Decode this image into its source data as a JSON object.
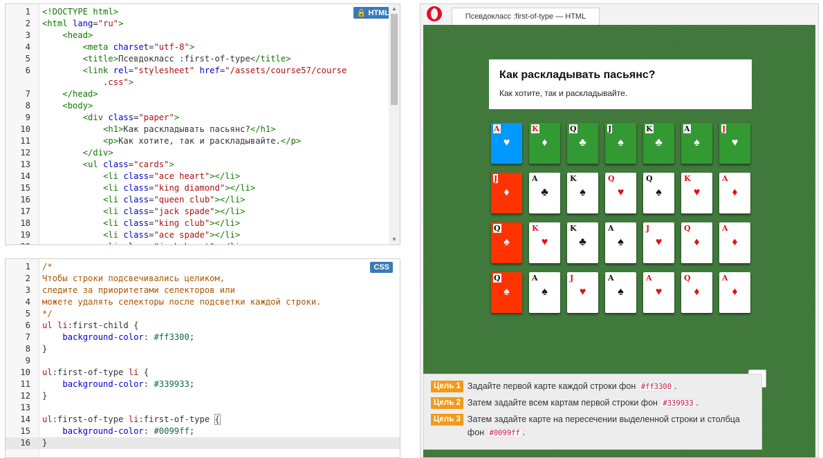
{
  "html_editor": {
    "badge": "HTML",
    "lines": [
      {
        "n": "1",
        "html": "<span class=\"t-tag\">&lt;!DOCTYPE html&gt;</span>"
      },
      {
        "n": "2",
        "html": "<span class=\"t-tag\">&lt;html</span> <span class=\"t-attr\">lang</span>=<span class=\"t-str\">\"ru\"</span><span class=\"t-tag\">&gt;</span>"
      },
      {
        "n": "3",
        "html": "    <span class=\"t-tag\">&lt;head&gt;</span>"
      },
      {
        "n": "4",
        "html": "        <span class=\"t-tag\">&lt;meta</span> <span class=\"t-attr\">charset</span>=<span class=\"t-str\">\"utf-8\"</span><span class=\"t-tag\">&gt;</span>"
      },
      {
        "n": "5",
        "html": "        <span class=\"t-tag\">&lt;title&gt;</span>Псевдокласс :first-of-type<span class=\"t-tag\">&lt;/title&gt;</span>"
      },
      {
        "n": "6",
        "html": "        <span class=\"t-tag\">&lt;link</span> <span class=\"t-attr\">rel</span>=<span class=\"t-str\">\"stylesheet\"</span> <span class=\"t-attr\">href</span>=<span class=\"t-str\">\"/assets/course57/course</span>"
      },
      {
        "n": "",
        "html": "            <span class=\"t-str\">.css\"</span><span class=\"t-tag\">&gt;</span>"
      },
      {
        "n": "7",
        "html": "    <span class=\"t-tag\">&lt;/head&gt;</span>"
      },
      {
        "n": "8",
        "html": "    <span class=\"t-tag\">&lt;body&gt;</span>"
      },
      {
        "n": "9",
        "html": "        <span class=\"t-tag\">&lt;div</span> <span class=\"t-attr\">class</span>=<span class=\"t-str\">\"paper\"</span><span class=\"t-tag\">&gt;</span>"
      },
      {
        "n": "10",
        "html": "            <span class=\"t-tag\">&lt;h1&gt;</span>Как раскладывать пасьянс?<span class=\"t-tag\">&lt;/h1&gt;</span>"
      },
      {
        "n": "11",
        "html": "            <span class=\"t-tag\">&lt;p&gt;</span>Как хотите, так и раскладывайте.<span class=\"t-tag\">&lt;/p&gt;</span>"
      },
      {
        "n": "12",
        "html": "        <span class=\"t-tag\">&lt;/div&gt;</span>"
      },
      {
        "n": "13",
        "html": "        <span class=\"t-tag\">&lt;ul</span> <span class=\"t-attr\">class</span>=<span class=\"t-str\">\"cards\"</span><span class=\"t-tag\">&gt;</span>"
      },
      {
        "n": "14",
        "html": "            <span class=\"t-tag\">&lt;li</span> <span class=\"t-attr\">class</span>=<span class=\"t-str\">\"ace heart\"</span><span class=\"t-tag\">&gt;&lt;/li&gt;</span>"
      },
      {
        "n": "15",
        "html": "            <span class=\"t-tag\">&lt;li</span> <span class=\"t-attr\">class</span>=<span class=\"t-str\">\"king diamond\"</span><span class=\"t-tag\">&gt;&lt;/li&gt;</span>"
      },
      {
        "n": "16",
        "html": "            <span class=\"t-tag\">&lt;li</span> <span class=\"t-attr\">class</span>=<span class=\"t-str\">\"queen club\"</span><span class=\"t-tag\">&gt;&lt;/li&gt;</span>"
      },
      {
        "n": "17",
        "html": "            <span class=\"t-tag\">&lt;li</span> <span class=\"t-attr\">class</span>=<span class=\"t-str\">\"jack spade\"</span><span class=\"t-tag\">&gt;&lt;/li&gt;</span>"
      },
      {
        "n": "18",
        "html": "            <span class=\"t-tag\">&lt;li</span> <span class=\"t-attr\">class</span>=<span class=\"t-str\">\"king club\"</span><span class=\"t-tag\">&gt;&lt;/li&gt;</span>"
      },
      {
        "n": "19",
        "html": "            <span class=\"t-tag\">&lt;li</span> <span class=\"t-attr\">class</span>=<span class=\"t-str\">\"ace spade\"</span><span class=\"t-tag\">&gt;&lt;/li&gt;</span>"
      },
      {
        "n": "20",
        "html": "            <span class=\"t-tag\">&lt;li</span> <span class=\"t-attr\">class</span>=<span class=\"t-str\">\"jack heart\"</span><span class=\"t-tag\">&gt;&lt;/li&gt;</span>"
      }
    ]
  },
  "css_editor": {
    "badge": "CSS",
    "active_line": "16",
    "lines": [
      {
        "n": "1",
        "html": "<span class=\"t-cm\">/*</span>"
      },
      {
        "n": "2",
        "html": "<span class=\"t-cm\">Чтобы строки подсвечивались целиком,</span>"
      },
      {
        "n": "3",
        "html": "<span class=\"t-cm\">следите за приоритетами селекторов или</span>"
      },
      {
        "n": "4",
        "html": "<span class=\"t-cm\">можете удалять селекторы после подсветки каждой строки.</span>"
      },
      {
        "n": "5",
        "html": "<span class=\"t-cm\">*/</span>"
      },
      {
        "n": "6",
        "html": "<span class=\"t-sel\">ul li</span>:first-child {"
      },
      {
        "n": "7",
        "html": "    <span class=\"t-prop\">background-color</span>: <span class=\"t-num\">#ff3300</span>;"
      },
      {
        "n": "8",
        "html": "}"
      },
      {
        "n": "9",
        "html": ""
      },
      {
        "n": "10",
        "html": "<span class=\"t-sel\">ul</span>:first-of-type <span class=\"t-sel\">li</span> {"
      },
      {
        "n": "11",
        "html": "    <span class=\"t-prop\">background-color</span>: <span class=\"t-num\">#339933</span>;"
      },
      {
        "n": "12",
        "html": "}"
      },
      {
        "n": "13",
        "html": ""
      },
      {
        "n": "14",
        "html": "<span class=\"t-sel\">ul</span>:first-of-type <span class=\"t-sel\">li</span>:first-of-type <span style=\"outline:1px solid #999\">{</span>"
      },
      {
        "n": "15",
        "html": "    <span class=\"t-prop\">background-color</span>: <span class=\"t-num\">#0099ff</span>;"
      },
      {
        "n": "16",
        "html": "}"
      }
    ]
  },
  "preview": {
    "tab_title": "Псевдокласс :first-of-type — HTML",
    "paper_title": "Как раскладывать пасьянс?",
    "paper_text": "Как хотите, так и раскладывайте.",
    "colors": {
      "row_first": "#ff3300",
      "first_row": "#339933",
      "intersection": "#0099ff"
    },
    "card_rows": [
      [
        {
          "rank": "A",
          "suit": "♥",
          "color": "red",
          "bg": "blue"
        },
        {
          "rank": "K",
          "suit": "♦",
          "color": "red",
          "bg": "green"
        },
        {
          "rank": "Q",
          "suit": "♣",
          "color": "black",
          "bg": "green"
        },
        {
          "rank": "J",
          "suit": "♠",
          "color": "black",
          "bg": "green"
        },
        {
          "rank": "K",
          "suit": "♣",
          "color": "black",
          "bg": "green"
        },
        {
          "rank": "A",
          "suit": "♠",
          "color": "black",
          "bg": "green"
        },
        {
          "rank": "J",
          "suit": "♥",
          "color": "red",
          "bg": "green"
        }
      ],
      [
        {
          "rank": "J",
          "suit": "♦",
          "color": "red",
          "bg": "orange"
        },
        {
          "rank": "A",
          "suit": "♣",
          "color": "black",
          "bg": ""
        },
        {
          "rank": "K",
          "suit": "♠",
          "color": "black",
          "bg": ""
        },
        {
          "rank": "Q",
          "suit": "♥",
          "color": "red",
          "bg": ""
        },
        {
          "rank": "Q",
          "suit": "♠",
          "color": "black",
          "bg": ""
        },
        {
          "rank": "K",
          "suit": "♥",
          "color": "red",
          "bg": ""
        },
        {
          "rank": "A",
          "suit": "♦",
          "color": "red",
          "bg": ""
        }
      ],
      [
        {
          "rank": "Q",
          "suit": "♠",
          "color": "black",
          "bg": "orange"
        },
        {
          "rank": "K",
          "suit": "♥",
          "color": "red",
          "bg": ""
        },
        {
          "rank": "K",
          "suit": "♣",
          "color": "black",
          "bg": ""
        },
        {
          "rank": "A",
          "suit": "♠",
          "color": "black",
          "bg": ""
        },
        {
          "rank": "J",
          "suit": "♥",
          "color": "red",
          "bg": ""
        },
        {
          "rank": "Q",
          "suit": "♦",
          "color": "red",
          "bg": ""
        },
        {
          "rank": "A",
          "suit": "♦",
          "color": "red",
          "bg": ""
        }
      ],
      [
        {
          "rank": "Q",
          "suit": "♠",
          "color": "black",
          "bg": "orange"
        },
        {
          "rank": "A",
          "suit": "♠",
          "color": "black",
          "bg": ""
        },
        {
          "rank": "J",
          "suit": "♥",
          "color": "red",
          "bg": ""
        },
        {
          "rank": "A",
          "suit": "♠",
          "color": "black",
          "bg": ""
        },
        {
          "rank": "A",
          "suit": "♥",
          "color": "red",
          "bg": ""
        },
        {
          "rank": "Q",
          "suit": "♦",
          "color": "red",
          "bg": ""
        },
        {
          "rank": "A",
          "suit": "♦",
          "color": "red",
          "bg": ""
        }
      ]
    ]
  },
  "tasks": [
    {
      "label": "Цель 1",
      "before": "Задайте первой карте каждой строки фон ",
      "code": "#ff3300",
      "after": "."
    },
    {
      "label": "Цель 2",
      "before": "Затем задайте всем картам первой строки фон ",
      "code": "#339933",
      "after": "."
    },
    {
      "label": "Цель 3",
      "before": "Затем задайте карте на пересечении выделенной строки и столбца фон ",
      "code": "#0099ff",
      "after": "."
    }
  ],
  "icons": {
    "up_button": "arrow-up-icon",
    "browser_logo": "opera-logo-icon",
    "lock": "lock-icon"
  }
}
